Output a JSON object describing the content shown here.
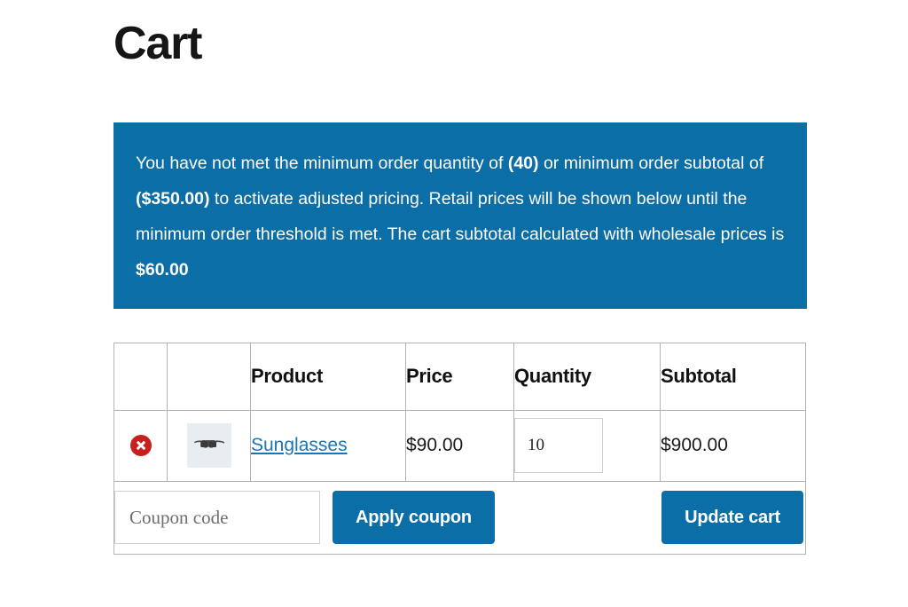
{
  "page": {
    "title": "Cart"
  },
  "notice": {
    "segments": [
      {
        "text": "You have not met the minimum order quantity of ",
        "bold": false
      },
      {
        "text": "(40)",
        "bold": true
      },
      {
        "text": " or minimum order subtotal of ",
        "bold": false
      },
      {
        "text": "($350.00)",
        "bold": true
      },
      {
        "text": " to activate adjusted pricing. Retail prices will be shown below until the minimum order threshold is met. The cart subtotal calculated with wholesale prices is ",
        "bold": false
      },
      {
        "text": "$60.00",
        "bold": true
      }
    ],
    "min_quantity": "(40)",
    "min_subtotal": "($350.00)",
    "wholesale_subtotal": "$60.00",
    "background_color": "#0b6ea6"
  },
  "cart": {
    "headers": {
      "remove": "",
      "thumbnail": "",
      "product": "Product",
      "price": "Price",
      "quantity": "Quantity",
      "subtotal": "Subtotal"
    },
    "rows": [
      {
        "remove_icon": "remove-circle-x-icon",
        "thumbnail_icon": "sunglasses-thumbnail",
        "product": "Sunglasses",
        "price": "$90.00",
        "quantity": "10",
        "subtotal": "$900.00"
      }
    ],
    "link_color": "#1876b8",
    "remove_color": "#c8201f"
  },
  "actions": {
    "coupon_placeholder": "Coupon code",
    "coupon_value": "",
    "apply_coupon_label": "Apply coupon",
    "update_cart_label": "Update cart",
    "button_color": "#0b6ea6"
  }
}
